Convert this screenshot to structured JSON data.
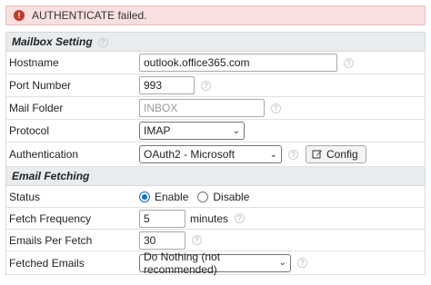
{
  "error": {
    "icon": "!",
    "message": "AUTHENTICATE failed."
  },
  "mailbox_section": {
    "title": "Mailbox Setting",
    "help_icon": "?"
  },
  "hostname": {
    "label": "Hostname",
    "value": "outlook.office365.com"
  },
  "port": {
    "label": "Port Number",
    "value": "993"
  },
  "folder": {
    "label": "Mail Folder",
    "placeholder": "INBOX"
  },
  "protocol": {
    "label": "Protocol",
    "selected": "IMAP"
  },
  "authentication": {
    "label": "Authentication",
    "selected": "OAuth2 - Microsoft",
    "config_label": "Config",
    "config_icon": "edit-icon"
  },
  "fetching_section": {
    "title": "Email Fetching"
  },
  "status": {
    "label": "Status",
    "options": [
      "Enable",
      "Disable"
    ],
    "selected": "Enable"
  },
  "fetch_frequency": {
    "label": "Fetch Frequency",
    "value": "5",
    "unit": "minutes"
  },
  "emails_per_fetch": {
    "label": "Emails Per Fetch",
    "value": "30"
  },
  "fetched_emails": {
    "label": "Fetched Emails",
    "selected": "Do Nothing (not recommended)"
  },
  "colors": {
    "error_bg": "#f9e0e0",
    "error_icon": "#c0392b",
    "section_bg": "#e9ecef",
    "radio_accent": "#0b6fd6"
  }
}
